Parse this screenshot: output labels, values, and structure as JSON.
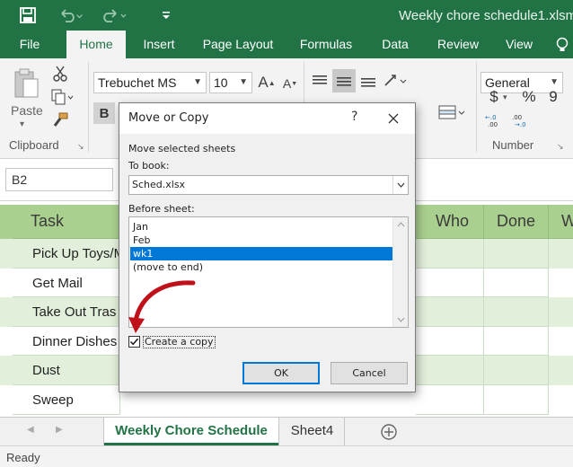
{
  "app": {
    "title": "Weekly chore schedule1.xlsm",
    "accent": "#217346"
  },
  "quick_access": {
    "icons": [
      "save-icon",
      "undo-icon",
      "redo-icon",
      "customize-quick-access-icon"
    ]
  },
  "ribbon_tabs": [
    {
      "label": "File"
    },
    {
      "label": "Home"
    },
    {
      "label": "Insert"
    },
    {
      "label": "Page Layout"
    },
    {
      "label": "Formulas"
    },
    {
      "label": "Data"
    },
    {
      "label": "Review"
    },
    {
      "label": "View"
    }
  ],
  "ribbon": {
    "paste_label": "Paste",
    "clipboard_label": "Clipboard",
    "font_name": "Trebuchet MS",
    "font_size": "10",
    "bold_label": "B",
    "number_format": "General",
    "number_label": "Number",
    "currency_symbol": "$",
    "percent_symbol": "%",
    "comma_symbol": "9"
  },
  "namebox": {
    "value": "B2"
  },
  "sheet": {
    "header_task": "Task",
    "header_who": "Who",
    "header_done": "Done",
    "header_next": "W",
    "tasks": [
      "Pick Up Toys/M",
      "Get Mail",
      "Take Out Tras",
      "Dinner Dishes",
      "Dust",
      "Sweep"
    ],
    "band_color": "#e2efda",
    "header_color": "#a9d08e"
  },
  "sheet_tabs": [
    {
      "label": "Weekly Chore Schedule"
    },
    {
      "label": "Sheet4"
    }
  ],
  "status": {
    "text": "Ready"
  },
  "dialog": {
    "title": "Move or Copy",
    "help": "?",
    "subtitle": "Move selected sheets",
    "to_book_label": "To book:",
    "to_book_value": "Sched.xlsx",
    "before_sheet_label": "Before sheet:",
    "sheets": [
      "Jan",
      "Feb",
      "wk1",
      "(move to end)"
    ],
    "selected_index": 2,
    "create_copy_label": "Create a copy",
    "create_copy_checked": true,
    "ok_label": "OK",
    "cancel_label": "Cancel"
  }
}
